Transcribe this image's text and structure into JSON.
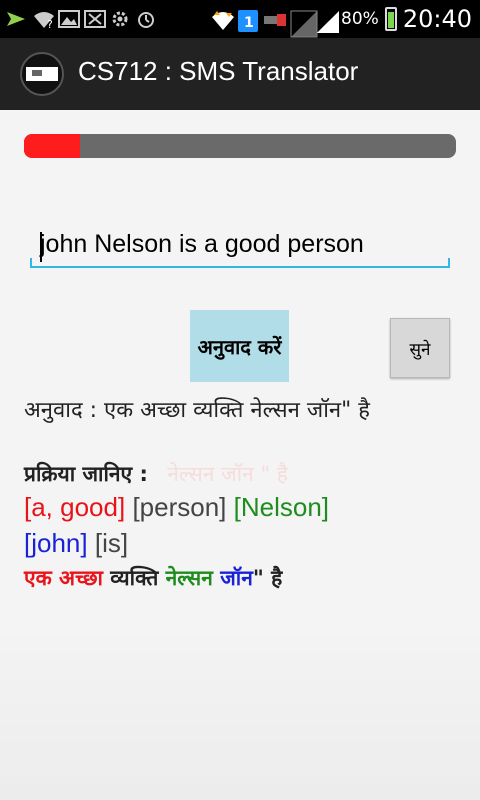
{
  "status_bar": {
    "battery_percent": "80%",
    "time": "20:40",
    "battery_level": 0.8
  },
  "app": {
    "title": "CS712 : SMS Translator"
  },
  "progress": {
    "value": 0.13,
    "color": "#ff1c1c",
    "track_color": "#6a6a6a"
  },
  "input": {
    "value": "john Nelson is a good person"
  },
  "buttons": {
    "translate_label": "अनुवाद करें",
    "listen_label": "सुने"
  },
  "translation": {
    "text": "अनुवाद : एक अच्छा व्यक्ति नेल्सन जॉन\" है"
  },
  "process": {
    "label": "प्रक्रिया जानिए :",
    "faded_text": "नेल्सन जॉन \" है"
  },
  "tokens": {
    "line1": [
      {
        "text": "[a, good]",
        "color": "#e8141a"
      },
      {
        "text": "[person]",
        "color": "#444444"
      },
      {
        "text": "[Nelson]",
        "color": "#1e8c1e"
      }
    ],
    "line2": [
      {
        "text": "[john]",
        "color": "#1a22d6"
      },
      {
        "text": "[is]",
        "color": "#444444"
      }
    ],
    "line3": [
      {
        "text": "एक अच्छा",
        "color": "#e8141a"
      },
      {
        "text": "व्यक्ति",
        "color": "#222222"
      },
      {
        "text": "नेल्सन",
        "color": "#1e8c1e"
      },
      {
        "text": "जॉन",
        "color": "#1a22d6"
      },
      {
        "text": "\" है",
        "color": "#222222"
      }
    ]
  }
}
